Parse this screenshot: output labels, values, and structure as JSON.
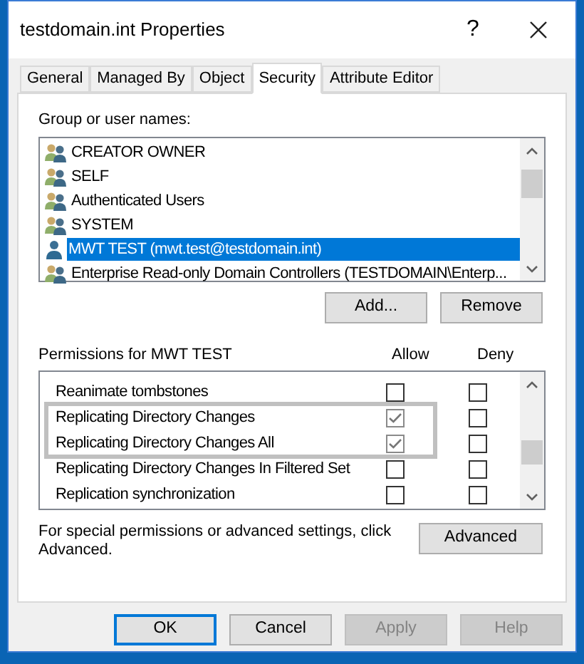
{
  "window": {
    "title": "testdomain.int Properties",
    "help_button": "?"
  },
  "tabs": [
    {
      "label": "General",
      "selected": false
    },
    {
      "label": "Managed By",
      "selected": false
    },
    {
      "label": "Object",
      "selected": false
    },
    {
      "label": "Security",
      "selected": true
    },
    {
      "label": "Attribute Editor",
      "selected": false
    }
  ],
  "users": {
    "label": "Group or user names:",
    "items": [
      {
        "name": "CREATOR OWNER",
        "kind": "group",
        "selected": false
      },
      {
        "name": "SELF",
        "kind": "group",
        "selected": false
      },
      {
        "name": "Authenticated Users",
        "kind": "group",
        "selected": false
      },
      {
        "name": "SYSTEM",
        "kind": "group",
        "selected": false
      },
      {
        "name": "MWT TEST (mwt.test@testdomain.int)",
        "kind": "user",
        "selected": true
      },
      {
        "name": "Enterprise Read-only Domain Controllers (TESTDOMAIN\\Enterp...",
        "kind": "group",
        "selected": false
      }
    ],
    "buttons": [
      "Add...",
      "Remove"
    ]
  },
  "permissions": {
    "label": "Permissions for MWT TEST",
    "columns": [
      "Allow",
      "Deny"
    ],
    "rows": [
      {
        "name": "Reanimate tombstones",
        "allow": false,
        "deny": false,
        "highlighted": false
      },
      {
        "name": "Replicating Directory Changes",
        "allow": true,
        "deny": false,
        "highlighted": true
      },
      {
        "name": "Replicating Directory Changes All",
        "allow": true,
        "deny": false,
        "highlighted": true
      },
      {
        "name": "Replicating Directory Changes In Filtered Set",
        "allow": false,
        "deny": false,
        "highlighted": false
      },
      {
        "name": "Replication synchronization",
        "allow": false,
        "deny": false,
        "highlighted": false
      }
    ]
  },
  "advanced": {
    "text": "For special permissions or advanced settings, click Advanced.",
    "button": "Advanced"
  },
  "footer_buttons": [
    {
      "label": "OK",
      "disabled": false,
      "default": true
    },
    {
      "label": "Cancel",
      "disabled": false,
      "default": false
    },
    {
      "label": "Apply",
      "disabled": true,
      "default": false
    },
    {
      "label": "Help",
      "disabled": true,
      "default": false
    }
  ]
}
